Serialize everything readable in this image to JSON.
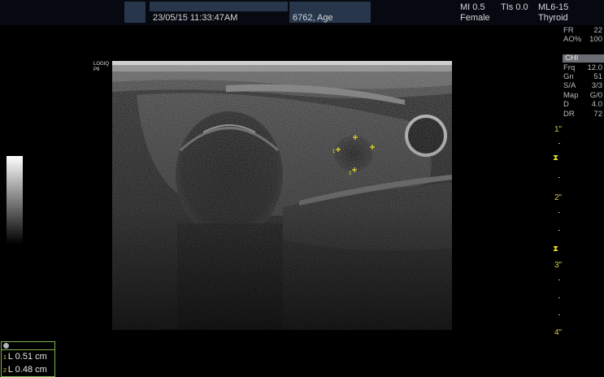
{
  "header": {
    "datetime": "23/05/15 11:33:47AM",
    "patient_id": "6762, Age",
    "mi": "MI 0.5",
    "tis": "TIs 0.0",
    "probe": "ML6-15",
    "sex": "Female",
    "preset": "Thyroid"
  },
  "params": [
    {
      "key": "FR",
      "value": "22"
    },
    {
      "key": "AO%",
      "value": "100"
    },
    {
      "key": "Frq",
      "value": "12.0"
    },
    {
      "key": "Gn",
      "value": "51"
    },
    {
      "key": "S/A",
      "value": "3/3"
    },
    {
      "key": "Map",
      "value": "G/0"
    },
    {
      "key": "D",
      "value": "4.0"
    },
    {
      "key": "DR",
      "value": "72"
    }
  ],
  "mode_label": "CHI",
  "depth_labels": [
    "1\"",
    "2\"",
    "3\"",
    "4\""
  ],
  "probe_label": {
    "line1": "LOGIQ",
    "line2": "P9"
  },
  "measurements": [
    {
      "index": "1",
      "text": "L 0.51 cm"
    },
    {
      "index": "2",
      "text": "L 0.48 cm"
    }
  ],
  "colors": {
    "caliper": "#e6dc30",
    "measure_border": "#7fb24a",
    "header_bg": "#060a10"
  }
}
